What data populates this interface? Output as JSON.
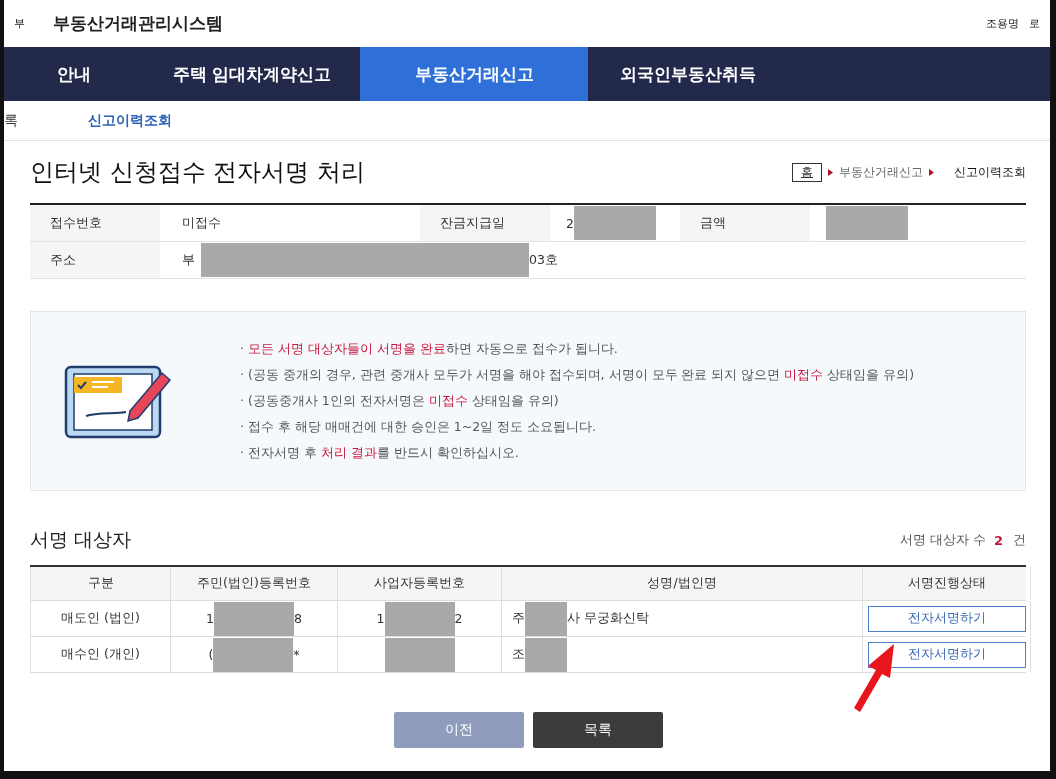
{
  "header": {
    "title_fragment": "부",
    "title": "부동산거래관리시스템",
    "user": "조용명",
    "logout_fragment": "로"
  },
  "nav": [
    {
      "label": "안내",
      "selected": false
    },
    {
      "label": "주택 임대차계약신고",
      "selected": false
    },
    {
      "label": "부동산거래신고",
      "selected": true
    },
    {
      "label": "외국인부동산취득",
      "selected": false
    }
  ],
  "subnav": [
    {
      "label": "록",
      "selected": false
    },
    {
      "label": "신고이력조회",
      "selected": true
    }
  ],
  "page_title": "인터넷 신청접수 전자서명 처리",
  "breadcrumb": [
    "홈",
    "부동산거래신고",
    "신고이력조회"
  ],
  "info": [
    [
      {
        "label": "접수번호",
        "value": {
          "prefix": "미접수"
        }
      },
      {
        "label": "잔금지급일",
        "value": {
          "prefix": "2",
          "redacted": true
        }
      },
      {
        "label": "금액",
        "value": {
          "redacted": true
        }
      }
    ],
    [
      {
        "label": "주소",
        "value": {
          "prefix": "부",
          "redacted": true,
          "suffix": "03호"
        }
      }
    ]
  ],
  "notices": [
    "· **모든 서명 대상자들이 서명을 완료**하면 자동으로 접수가 됩니다.",
    "· (공동 중개의 경우, 관련 중개사 모두가 서명을 해야 접수되며, 서명이 모두 완료 되지 않으면 **미접수** 상태임을 유의)",
    "· (공동중개사 1인의 전자서명은 **미접수** 상태임을 유의)",
    "· 접수 후 해당 매매건에 대한 승인은 1~2일 정도 소요됩니다.",
    "· 전자서명 후 **처리 결과**를 반드시 확인하십시오."
  ],
  "signers": {
    "title": "서명 대상자",
    "count_label": "서명 대상자 수",
    "count": "2",
    "count_unit": "건",
    "columns": [
      "구분",
      "주민(법인)등록번호",
      "사업자등록번호",
      "성명/법인명",
      "서명진행상태"
    ],
    "rows": [
      {
        "type": "매도인 (법인)",
        "id": {
          "prefix": "1",
          "redacted": true,
          "suffix": "8"
        },
        "biz": {
          "prefix": "1",
          "redacted": true,
          "suffix": "2"
        },
        "name": {
          "prefix": "주",
          "redacted": true,
          "suffix": "사 무궁화신탁"
        },
        "action": "전자서명하기"
      },
      {
        "type": "매수인 (개인)",
        "id": {
          "prefix": "(",
          "redacted": true,
          "suffix": "*"
        },
        "biz": {
          "redacted": true
        },
        "name": {
          "prefix": "조",
          "redacted": true
        },
        "action": "전자서명하기"
      }
    ]
  },
  "buttons": [
    {
      "label": "이전",
      "kind": "disabled"
    },
    {
      "label": "목록",
      "kind": "primary"
    }
  ]
}
